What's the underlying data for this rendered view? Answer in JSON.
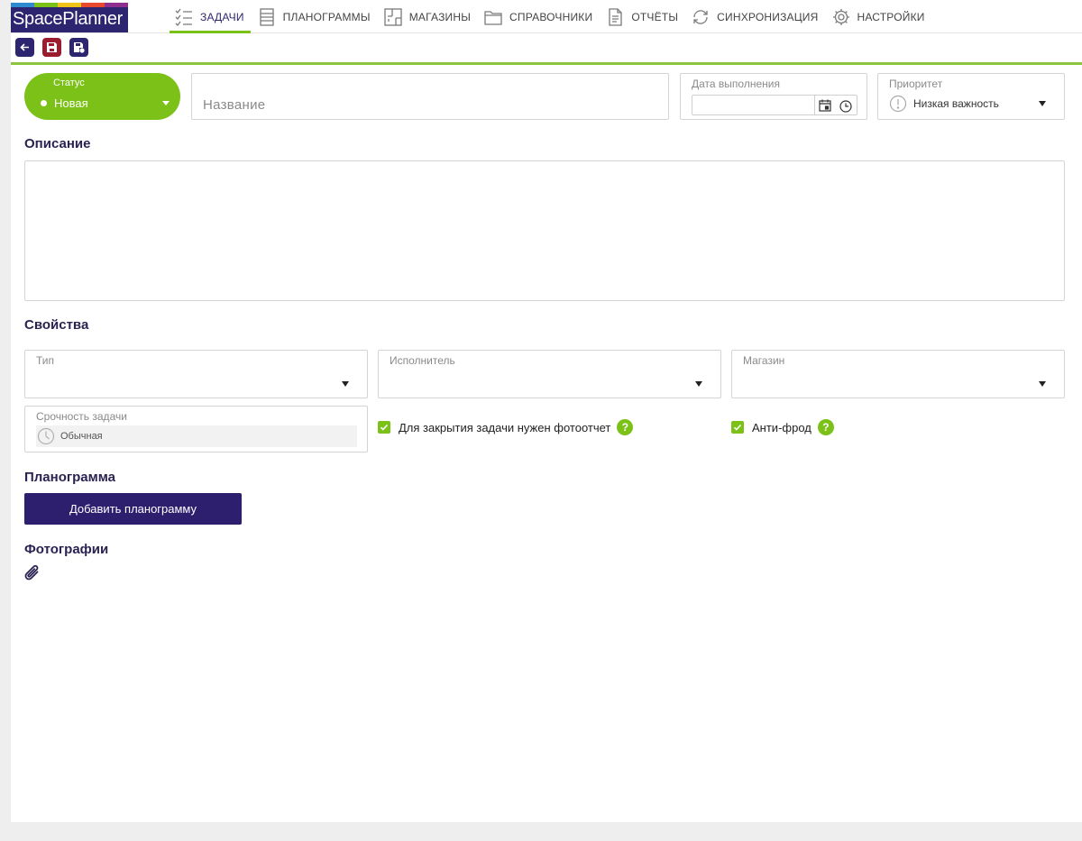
{
  "app": {
    "logo_text": "SpacePlanner",
    "logo_colors": [
      "#2e8bd0",
      "#7cc118",
      "#f0c419",
      "#e8482b",
      "#8e2f8f"
    ]
  },
  "nav": [
    {
      "label": "ЗАДАЧИ",
      "icon": "tasks-icon",
      "active": true
    },
    {
      "label": "ПЛАНОГРАММЫ",
      "icon": "planogram-icon",
      "active": false
    },
    {
      "label": "МАГАЗИНЫ",
      "icon": "store-layout-icon",
      "active": false
    },
    {
      "label": "СПРАВОЧНИКИ",
      "icon": "folder-icon",
      "active": false
    },
    {
      "label": "ОТЧЁТЫ",
      "icon": "report-icon",
      "active": false
    },
    {
      "label": "СИНХРОНИЗАЦИЯ",
      "icon": "sync-icon",
      "active": false
    },
    {
      "label": "НАСТРОЙКИ",
      "icon": "gear-icon",
      "active": false
    }
  ],
  "toolbar": {
    "back": "back-arrow-icon",
    "save": "save-icon",
    "save_as": "save-as-icon"
  },
  "status": {
    "caption": "Статус",
    "value": "Новая"
  },
  "name": {
    "placeholder": "Название",
    "value": ""
  },
  "due_date": {
    "caption": "Дата выполнения",
    "value": ""
  },
  "priority": {
    "caption": "Приоритет",
    "value": "Низкая важность"
  },
  "description": {
    "title": "Описание",
    "value": ""
  },
  "properties": {
    "title": "Свойства",
    "type": {
      "caption": "Тип",
      "value": ""
    },
    "assignee": {
      "caption": "Исполнитель",
      "value": ""
    },
    "store": {
      "caption": "Магазин",
      "value": ""
    },
    "urgency": {
      "caption": "Срочность задачи",
      "value": "Обычная"
    },
    "photo_report": {
      "label": "Для закрытия задачи нужен фотоотчет",
      "checked": true,
      "help": "?"
    },
    "anti_fraud": {
      "label": "Анти-фрод",
      "checked": true,
      "help": "?"
    }
  },
  "planogram": {
    "title": "Планограмма",
    "add_button": "Добавить планограмму"
  },
  "photos": {
    "title": "Фотографии"
  },
  "colors": {
    "accent_green": "#7cc118",
    "brand_purple": "#2e2570",
    "save_red": "#9b1c2e"
  }
}
